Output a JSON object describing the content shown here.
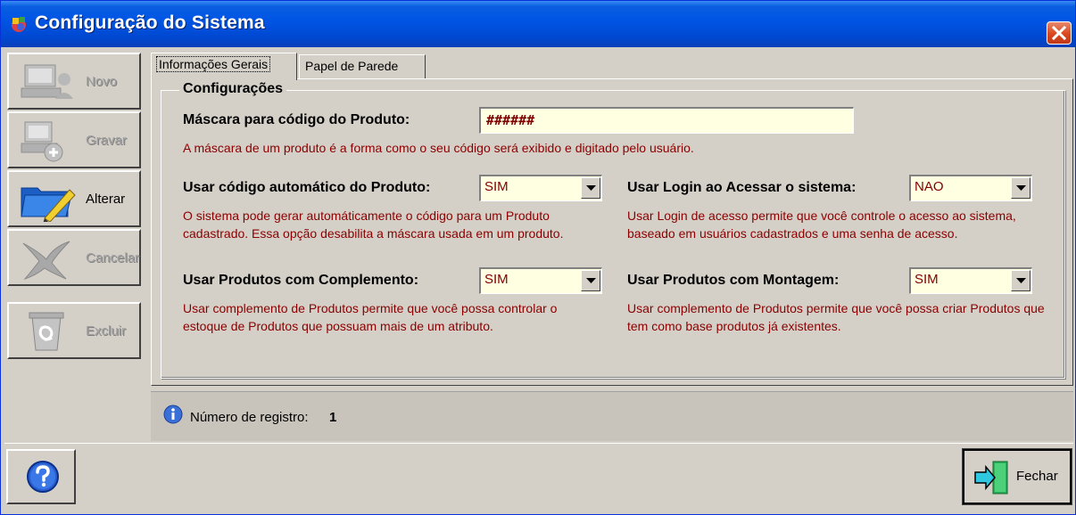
{
  "window": {
    "title": "Configuração do Sistema"
  },
  "sidebar": {
    "buttons": [
      {
        "label": "Novo",
        "enabled": false,
        "icon": "computer-user-icon"
      },
      {
        "label": "Gravar",
        "enabled": false,
        "icon": "save-computer-icon"
      },
      {
        "label": "Alterar",
        "enabled": true,
        "icon": "folder-edit-icon"
      },
      {
        "label": "Cancelar",
        "enabled": false,
        "icon": "cancel-x-icon"
      },
      {
        "label": "Excluir",
        "enabled": false,
        "icon": "recycle-bin-icon"
      }
    ]
  },
  "tabs": [
    {
      "label": "Informações Gerais",
      "active": true
    },
    {
      "label": "Papel de Parede",
      "active": false
    }
  ],
  "group": {
    "title": "Configurações"
  },
  "fields": {
    "mask": {
      "label": "Máscara para código do Produto:",
      "value": "######",
      "description": "A máscara de um produto é a forma como o seu código será exibido e digitado pelo usuário."
    },
    "auto_code": {
      "label": "Usar código automático do Produto:",
      "value": "SIM",
      "description": "O sistema pode gerar automáticamente o código para um Produto cadastrado. Essa opção desabilita a máscara usada em um produto."
    },
    "login": {
      "label": "Usar Login ao Acessar o sistema:",
      "value": "NAO",
      "description": "Usar Login de acesso permite que você controle o acesso ao sistema, baseado em usuários cadastrados e uma senha de acesso."
    },
    "complement": {
      "label": "Usar Produtos com Complemento:",
      "value": "SIM",
      "description": "Usar complemento de Produtos permite que você possa controlar o estoque de Produtos que possuam mais de um atributo."
    },
    "assembly": {
      "label": "Usar Produtos com Montagem:",
      "value": "SIM",
      "description": "Usar complemento de Produtos permite que você possa criar Produtos que tem como base produtos já existentes."
    }
  },
  "status": {
    "label": "Número de registro:",
    "value": "1"
  },
  "footer": {
    "close_label": "Fechar"
  },
  "colors": {
    "title_bar": "#0055e5",
    "description_text": "#8b0000",
    "input_bg": "#ffffe1",
    "window_bg": "#d4d0c8"
  }
}
